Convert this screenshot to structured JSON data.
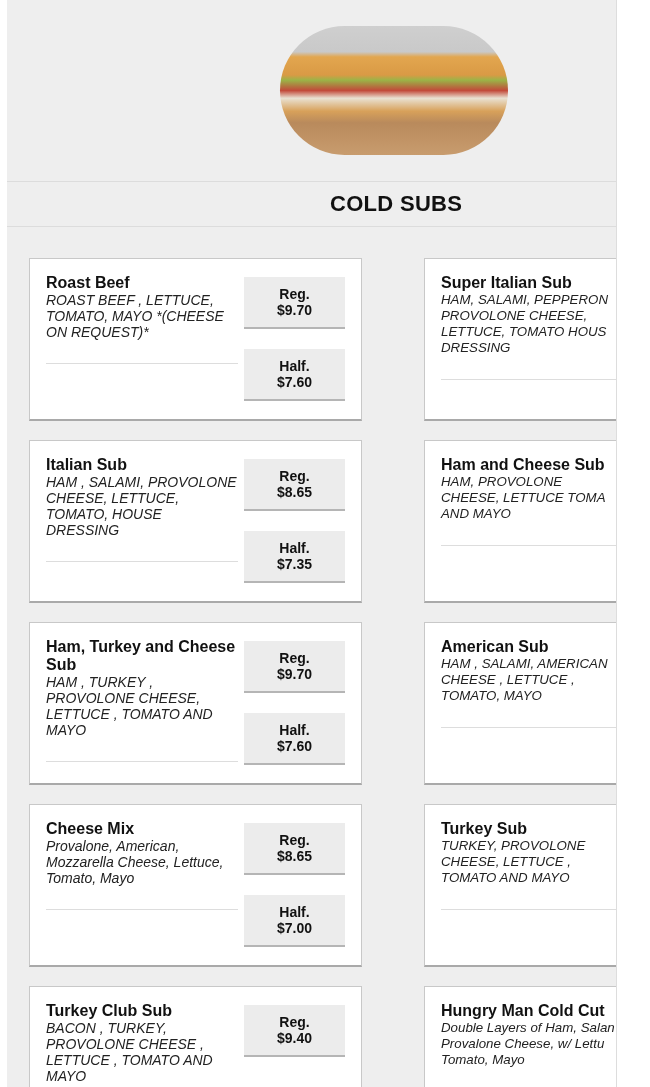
{
  "section": {
    "title": "COLD SUBS"
  },
  "left_column": [
    {
      "name": "Roast Beef",
      "description": "ROAST BEEF , LETTUCE, TOMATO, MAYO *(CHEESE ON REQUEST)*",
      "prices": [
        {
          "label": "Reg.",
          "amount": "$9.70"
        },
        {
          "label": "Half.",
          "amount": "$7.60"
        }
      ]
    },
    {
      "name": "Italian Sub",
      "description": "HAM , SALAMI, PROVOLONE CHEESE, LETTUCE, TOMATO, HOUSE DRESSING",
      "prices": [
        {
          "label": "Reg.",
          "amount": "$8.65"
        },
        {
          "label": "Half.",
          "amount": "$7.35"
        }
      ]
    },
    {
      "name": "Ham, Turkey and Cheese Sub",
      "description": "HAM , TURKEY , PROVOLONE CHEESE, LETTUCE , TOMATO AND MAYO",
      "prices": [
        {
          "label": "Reg.",
          "amount": "$9.70"
        },
        {
          "label": "Half.",
          "amount": "$7.60"
        }
      ]
    },
    {
      "name": "Cheese Mix",
      "description": "Provalone, American, Mozzarella Cheese, Lettuce, Tomato, Mayo",
      "prices": [
        {
          "label": "Reg.",
          "amount": "$8.65"
        },
        {
          "label": "Half.",
          "amount": "$7.00"
        }
      ]
    },
    {
      "name": "Turkey Club Sub",
      "description": "BACON , TURKEY, PROVOLONE CHEESE , LETTUCE , TOMATO AND MAYO",
      "prices": [
        {
          "label": "Reg.",
          "amount": "$9.40"
        }
      ]
    }
  ],
  "right_column": [
    {
      "name": "Super Italian Sub",
      "description": "HAM, SALAMI, PEPPERON\nPROVOLONE CHEESE,\nLETTUCE, TOMATO HOUS\nDRESSING"
    },
    {
      "name": "Ham and Cheese Sub",
      "description": "HAM, PROVOLONE\nCHEESE, LETTUCE TOMA\nAND MAYO"
    },
    {
      "name": "American Sub",
      "description": "HAM , SALAMI, AMERICAN\nCHEESE , LETTUCE ,\nTOMATO, MAYO"
    },
    {
      "name": "Turkey Sub",
      "description": "TURKEY, PROVOLONE\nCHEESE, LETTUCE ,\nTOMATO AND MAYO"
    },
    {
      "name": "Hungry Man Cold Cut",
      "description": "Double Layers of Ham, Salan\nProvalone Cheese, w/ Lettu\nTomato, Mayo"
    }
  ]
}
